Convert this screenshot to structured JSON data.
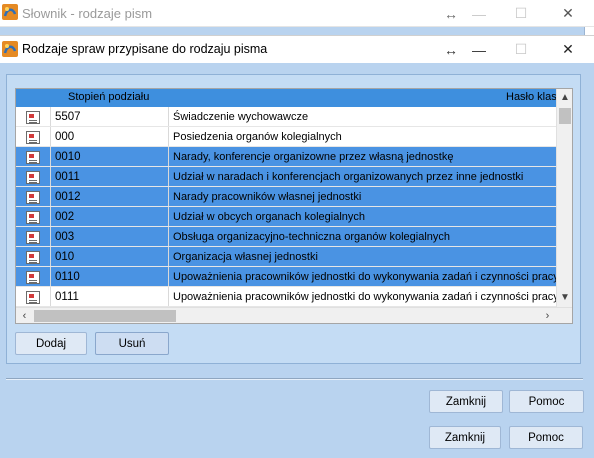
{
  "background_window": {
    "title": "Słownik - rodzaje pism",
    "buttons": {
      "close": "Zamknij",
      "help": "Pomoc"
    }
  },
  "dialog": {
    "title": "Rodzaje spraw przypisane do rodzaju pisma",
    "grid": {
      "columns": [
        "Stopień podziału",
        "Hasło klas"
      ],
      "rows": [
        {
          "code": "5507",
          "name": "Świadczenie wychowawcze",
          "selected": false
        },
        {
          "code": "000",
          "name": "Posiedzenia organów kolegialnych",
          "selected": false
        },
        {
          "code": "0010",
          "name": "Narady, konferencje organizowne przez własną jednostkę",
          "selected": true
        },
        {
          "code": "0011",
          "name": "Udział w naradach i konferencjach organizowanych przez inne jednostki",
          "selected": true
        },
        {
          "code": "0012",
          "name": "Narady pracowników własnej jednostki",
          "selected": true
        },
        {
          "code": "002",
          "name": "Udział w obcych organach kolegialnych",
          "selected": true
        },
        {
          "code": "003",
          "name": "Obsługa organizacyjno-techniczna organów kolegialnych",
          "selected": true
        },
        {
          "code": "010",
          "name": "Organizacja własnej jednostki",
          "selected": true
        },
        {
          "code": "0110",
          "name": "Upoważnienia pracowników jednostki do wykonywania zadań i czynności pracy",
          "selected": true
        },
        {
          "code": "0111",
          "name": "Upoważnienia pracowników jednostki do wykonywania zadań i czynności pracy",
          "selected": false
        }
      ]
    },
    "buttons": {
      "add": "Dodaj",
      "remove": "Usuń",
      "close": "Zamknij",
      "help": "Pomoc"
    }
  },
  "icons": {
    "app": "app-logo-icon",
    "resize": "↔",
    "minimize": "—",
    "maximize": "☐",
    "close": "✕",
    "row": "document-icon"
  },
  "colors": {
    "selection": "#4a93e3",
    "header": "#3e8fde",
    "dialog_bg": "#b9d3ef"
  }
}
